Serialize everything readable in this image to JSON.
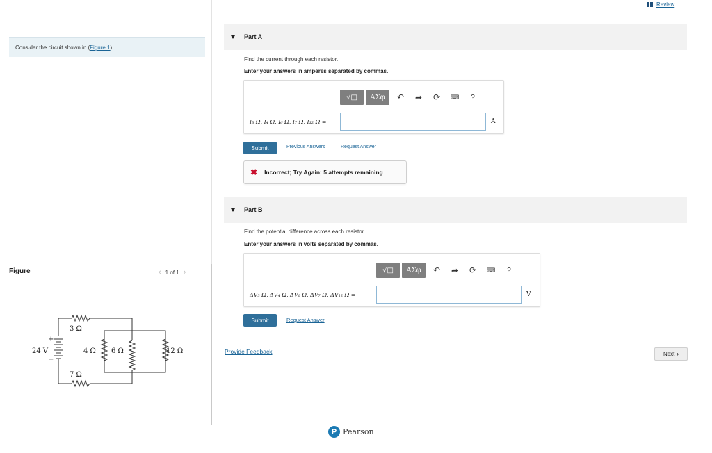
{
  "left": {
    "intro_text": "Consider the circuit shown in (",
    "intro_link": "Figure 1",
    "intro_close": ").",
    "figure_label": "Figure",
    "pager_text": "1 of 1"
  },
  "circuit": {
    "battery_label": "24 V",
    "plus": "+",
    "minus": "−",
    "r3": "3 Ω",
    "r4": "4 Ω",
    "r6": "6 Ω",
    "r7": "7 Ω",
    "r12": "12 Ω"
  },
  "header": {
    "review_label": "Review"
  },
  "partA": {
    "title": "Part A",
    "prompt": "Find the current through each resistor.",
    "instruction": "Enter your answers in amperes separated by commas.",
    "toolbar": {
      "templates": "√□",
      "greek": "AΣφ",
      "help": "?"
    },
    "equation_label": "I₃ Ω, I₄ Ω, I₆ Ω, I₇ Ω, I₁₂ Ω =",
    "input_value": "",
    "unit": "A",
    "submit_label": "Submit",
    "previous_answers": "Previous Answers",
    "request_answer": "Request Answer",
    "feedback": "Incorrect; Try Again; 5 attempts remaining"
  },
  "partB": {
    "title": "Part B",
    "prompt": "Find the potential difference across each resistor.",
    "instruction": "Enter your answers in volts separated by commas.",
    "toolbar": {
      "templates": "√□",
      "greek": "AΣφ",
      "help": "?"
    },
    "equation_label": "ΔV₃ Ω, ΔV₄ Ω, ΔV₆ Ω, ΔV₇ Ω, ΔV₁₂ Ω =",
    "input_value": "",
    "unit": "V",
    "submit_label": "Submit",
    "request_answer": "Request Answer"
  },
  "footer": {
    "provide_feedback": "Provide Feedback",
    "next_label": "Next",
    "brand": "Pearson",
    "brand_initial": "P"
  },
  "colors": {
    "primary": "#2f6f9a",
    "link": "#1a6496",
    "error": "#c8102e",
    "intro_bg": "#e9f2f6"
  }
}
